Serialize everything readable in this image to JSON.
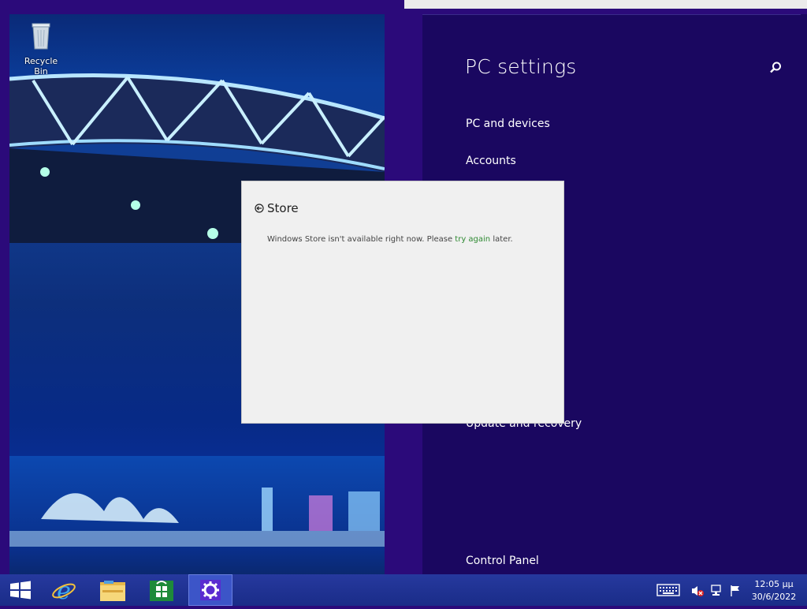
{
  "desktop": {
    "recycle_bin_label": "Recycle Bin"
  },
  "settings": {
    "title": "PC settings",
    "search_icon": "magnifier-icon",
    "items": [
      {
        "label": "PC and devices"
      },
      {
        "label": "Accounts"
      },
      {
        "label": "Update and recovery"
      },
      {
        "label": "Control Panel"
      }
    ]
  },
  "store_dialog": {
    "title": "Store",
    "message_before": "Windows Store isn't available right now. Please ",
    "link_text": "try again",
    "message_after": " later."
  },
  "taskbar": {
    "items": [
      {
        "name": "start-button",
        "icon": "windows-logo-icon"
      },
      {
        "name": "internet-explorer",
        "icon": "ie-icon"
      },
      {
        "name": "file-explorer",
        "icon": "folder-icon"
      },
      {
        "name": "store",
        "icon": "store-icon"
      },
      {
        "name": "pc-settings",
        "icon": "gear-icon",
        "active": true
      }
    ],
    "tray": [
      "keyboard-icon",
      "speaker-muted-icon",
      "network-icon",
      "flag-icon"
    ],
    "clock": {
      "time": "12:05 μμ",
      "date": "30/6/2022"
    }
  },
  "colors": {
    "settings_bg": "#1a0760",
    "desktop_bg": "#2b0a7a",
    "taskbar_bg": "#1f3290",
    "link_green": "#2f8a33"
  }
}
